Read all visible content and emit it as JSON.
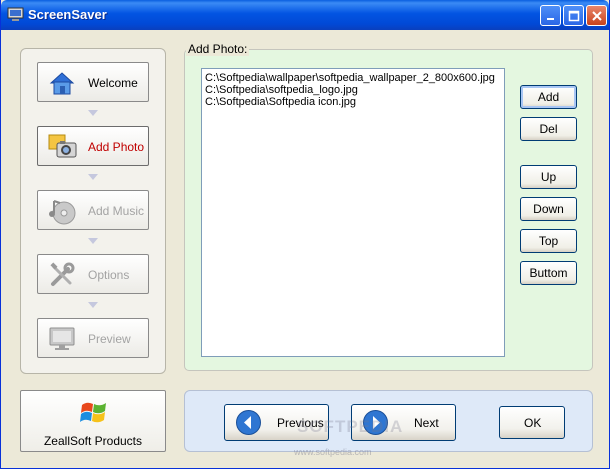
{
  "window": {
    "title": "ScreenSaver"
  },
  "nav": {
    "items": [
      {
        "label": "Welcome",
        "icon": "house-icon"
      },
      {
        "label": "Add Photo",
        "icon": "camera-photo-icon"
      },
      {
        "label": "Add Music",
        "icon": "music-disc-icon"
      },
      {
        "label": "Options",
        "icon": "tools-icon"
      },
      {
        "label": "Preview",
        "icon": "monitor-icon"
      }
    ]
  },
  "photo_panel": {
    "legend": "Add Photo:",
    "files": [
      "C:\\Softpedia\\wallpaper\\softpedia_wallpaper_2_800x600.jpg",
      "C:\\Softpedia\\softpedia_logo.jpg",
      "C:\\Softpedia\\Softpedia icon.jpg"
    ],
    "buttons": {
      "add": "Add",
      "del": "Del",
      "up": "Up",
      "down": "Down",
      "top": "Top",
      "bottom": "Buttom"
    }
  },
  "footer": {
    "products_label": "ZeallSoft Products",
    "previous_label": "Previous",
    "next_label": "Next",
    "ok_label": "OK"
  },
  "watermark": {
    "text": "SOFTPEDIA",
    "url": "www.softpedia.com"
  },
  "colors": {
    "title_blue": "#0254e2",
    "active_nav_label": "#c00000",
    "photo_panel_bg": "#e4f7e0",
    "bottom_bar_bg": "#dee9f8"
  }
}
